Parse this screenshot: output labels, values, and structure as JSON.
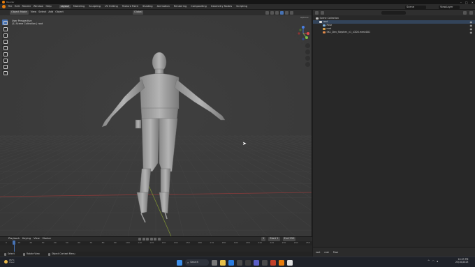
{
  "window": {
    "title": "Blender"
  },
  "menu": {
    "items": [
      "File",
      "Edit",
      "Render",
      "Window",
      "Help"
    ],
    "workspaces": [
      "Layout",
      "Modeling",
      "Sculpting",
      "UV Editing",
      "Texture Paint",
      "Shading",
      "Animation",
      "Rendering",
      "Compositing",
      "Geometry Nodes",
      "Scripting"
    ],
    "active_workspace": "Layout",
    "scene": "Scene",
    "view_layer": "ViewLayer"
  },
  "viewport": {
    "mode": "Object Mode",
    "menus": [
      "View",
      "Select",
      "Add",
      "Object"
    ],
    "transform_orientation": "Global",
    "options_label": "Options",
    "overlay_line1": "User Perspective",
    "overlay_line2": "(1) Scene Collection | root"
  },
  "outliner": {
    "rows": [
      {
        "label": "Scene Collection",
        "indent": 0
      },
      {
        "label": "root",
        "indent": 1
      },
      {
        "label": "Pose",
        "indent": 2
      },
      {
        "label": "root",
        "indent": 2
      },
      {
        "label": "SK1_Dev_Stephen_v1_LOD0.mesh001",
        "indent": 2
      }
    ]
  },
  "timeline": {
    "menus": [
      "Playback",
      "Keying",
      "View",
      "Marker"
    ],
    "current_frame": "1",
    "start_label": "Start",
    "start": "1",
    "end_label": "End",
    "end": "250",
    "ticks": [
      "0",
      "10",
      "20",
      "30",
      "40",
      "50",
      "60",
      "70",
      "80",
      "90",
      "100",
      "110",
      "120",
      "130",
      "140",
      "150",
      "160",
      "170",
      "180",
      "190",
      "200",
      "210",
      "220",
      "230",
      "240",
      "250"
    ]
  },
  "status": {
    "items": [
      "Select",
      "Rotate View",
      "Object Context Menu"
    ],
    "outliner_items": [
      "root",
      "root",
      "Pose"
    ]
  },
  "taskbar": {
    "weather_temp": "15°C",
    "weather_text": "Clear",
    "search": "Search",
    "time": "10:03 PM",
    "date": "23/10/2023"
  },
  "colors": {
    "accent": "#4772b3",
    "blender_orange": "#e87d0d",
    "viewport_bg": "#3c3c3c"
  }
}
